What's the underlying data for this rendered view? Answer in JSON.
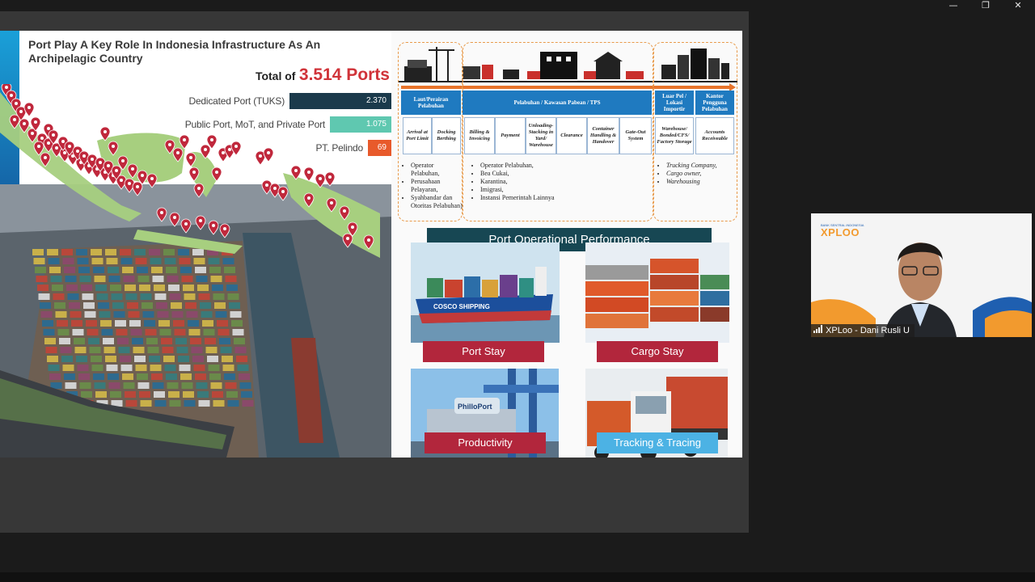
{
  "window": {
    "minimize": "—",
    "restore": "❐",
    "close": "✕"
  },
  "slide": {
    "title": "Port Play A Key Role In Indonesia Infrastructure As An Archipelagic Country",
    "total_label": "Total of",
    "total_value": "3.514 Ports",
    "stats": [
      {
        "label": "Dedicated Port (TUKS)",
        "value": "2.370",
        "value_num": 2370,
        "color": "#1b3a4b"
      },
      {
        "label": "Public Port, MoT, and Private Port",
        "value": "1.075",
        "value_num": 1075,
        "color": "#5fc8b0"
      },
      {
        "label": "PT. Pelindo",
        "value": "69",
        "value_num": 69,
        "color": "#e85a2b"
      }
    ],
    "process": {
      "groups": [
        {
          "header": "Laut/Perairan Pelabuhan",
          "steps": [
            "Arrival at Port Limit",
            "Docking Berthing"
          ],
          "actors": [
            "Operator Pelabuhan,",
            "Perusahaan Pelayaran,",
            "Syahbandar dan Otoritas Pelabuhan)"
          ],
          "actors_italic": false
        },
        {
          "header": "Pelabuhan / Kawasan Pabean / TPS",
          "steps": [
            "Billing & Invoicing",
            "Payment",
            "Unloading-Stacking in Yard/ Warehouse",
            "Clearance",
            "Container Handling & Handover",
            "Gate-Out System"
          ],
          "actors": [
            "Operator Pelabuhan,",
            "Bea Cukai,",
            "Karantina,",
            "Imigrasi,",
            "Instansi Pemerintah Lainnya"
          ],
          "actors_italic": false
        },
        {
          "headers": [
            "Luar Pel / Lokasi Importir",
            "Kantor Pengguna Pelabuhan"
          ],
          "steps": [
            "Warehouse/ Bonded/CFS/ Factory Storage",
            "Accounts Receiveable"
          ],
          "actors": [
            "Trucking Company,",
            "Cargo owner,",
            "Warehousing"
          ],
          "actors_italic": true
        }
      ]
    },
    "performance": {
      "title": "Port Operational Performance",
      "tiles": [
        {
          "label": "Port Stay",
          "color": "#b2263c",
          "ship_text": "COSCO SHIPPING"
        },
        {
          "label": "Cargo Stay",
          "color": "#b2263c"
        },
        {
          "label": "Productivity",
          "color": "#b2263c",
          "sign_text": "PhilloPort"
        },
        {
          "label": "Tracking & Tracing",
          "color": "#4cb2e4"
        }
      ]
    }
  },
  "webcam": {
    "logo_small": "BANK SENTRAL INDONESIA",
    "logo": "XPLOO",
    "participant": "XPLoo - Dani Rusli U"
  }
}
